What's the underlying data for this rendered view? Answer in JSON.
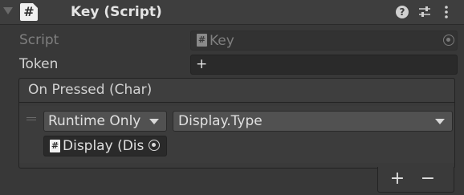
{
  "component": {
    "title": "Key (Script)",
    "icon": "script-icon",
    "help_icon": "help-icon",
    "presets_icon": "presets-icon",
    "menu_icon": "kebab-menu-icon"
  },
  "fields": {
    "script": {
      "label": "Script",
      "value": "Key"
    },
    "token": {
      "label": "Token",
      "value": "+"
    }
  },
  "event": {
    "header": "On Pressed (Char)",
    "listener": {
      "call_state": "Runtime Only",
      "function": "Display.Type",
      "target": "Display (Dis"
    },
    "add_label": "+",
    "remove_label": "−"
  }
}
